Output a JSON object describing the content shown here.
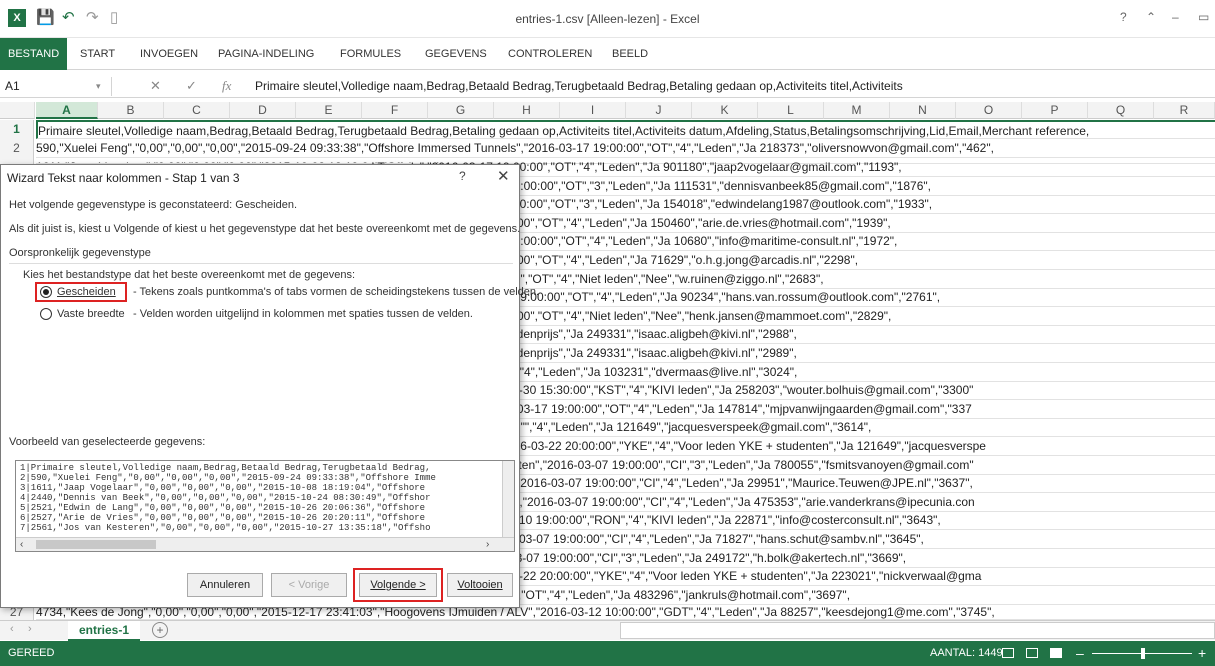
{
  "window": {
    "title": "entries-1.csv  [Alleen-lezen] - Excel",
    "excel_logo": "X",
    "controls": [
      "?",
      "⌃",
      "–",
      "▭"
    ]
  },
  "ribbon": {
    "tabs": [
      "BESTAND",
      "START",
      "INVOEGEN",
      "PAGINA-INDELING",
      "FORMULES",
      "GEGEVENS",
      "CONTROLEREN",
      "BEELD"
    ]
  },
  "formula_bar": {
    "name_box": "A1",
    "fx": "fx",
    "content": "Primaire sleutel,Volledige naam,Bedrag,Betaald Bedrag,Terugbetaald Bedrag,Betaling gedaan op,Activiteits titel,Activiteits"
  },
  "columns": [
    "A",
    "B",
    "C",
    "D",
    "E",
    "F",
    "G",
    "H",
    "I",
    "J",
    "K",
    "L",
    "M",
    "N",
    "O",
    "P",
    "Q",
    "R"
  ],
  "rows": [
    {
      "n": "1",
      "text": "Primaire sleutel,Volledige naam,Bedrag,Betaald Bedrag,Terugbetaald Bedrag,Betaling gedaan op,Activiteits titel,Activiteits datum,Afdeling,Status,Betalingsomschrijving,Lid,Email,Merchant reference,"
    },
    {
      "n": "2",
      "text": "590,\"Xuelei Feng\",\"0,00\",\"0,00\",\"0,00\",\"2015-09-24 09:33:38\",\"Offshore Immersed Tunnels\",\"2016-03-17 19:00:00\",\"OT\",\"4\",\"Leden\",\"Ja 218373\",\"oliversnowvon@gmail.com\",\"462\","
    }
  ],
  "right_rows": [
    "sed Tunnels\",\"2016-03-17 19:00:00\",\"OT\",\"4\",\"Leden\",\"Ja 901180\",\"jaap2vogelaar@gmail.com\",\"1193\",",
    "ersed Tunnels\",\"2016-03-17 19:00:00\",\"OT\",\"3\",\"Leden\",\"Ja 111531\",\"dennisvanbeek85@gmail.com\",\"1876\",",
    "sed Tunnels\",\"2016-03-17 19:00:00\",\"OT\",\"3\",\"Leden\",\"Ja 154018\",\"edwindelang1987@outlook.com\",\"1933\",",
    "d Tunnels\",\"2016-03-17 19:00:00\",\"OT\",\"4\",\"Leden\",\"Ja 150460\",\"arie.de.vries@hotmail.com\",\"1939\",",
    "ersed Tunnels\",\"2016-03-17 19:00:00\",\"OT\",\"4\",\"Leden\",\"Ja 10680\",\"info@maritime-consult.nl\",\"1972\",",
    "d Tunnels\",\"2016-03-17 19:00:00\",\"OT\",\"4\",\"Leden\",\"Ja 71629\",\"o.h.g.jong@arcadis.nl\",\"2298\",",
    "Tunnels\",\"2016-03-17 19:00:00\",\"OT\",\"4\",\"Niet leden\",\"Nee\",\"w.ruinen@ziggo.nl\",\"2683\",",
    "nersed Tunnels\",\"2016-03-17 19:00:00\",\"OT\",\"4\",\"Leden\",\"Ja 90234\",\"hans.van.rossum@outlook.com\",\"2761\",",
    "d Tunnels\",\"2016-03-17 19:00:00\",\"OT\",\"4\",\"Niet leden\",\"Nee\",\"henk.jansen@mammoet.com\",\"2829\",",
    "-03-18 08:00:00\",\"MAI\",\"3\",\"Ledenprijs\",\"Ja 249331\",\"isaac.aligbeh@kivi.nl\",\"2988\",",
    "-03-18 08:00:00\",\"MAI\",\"4\",\"Ledenprijs\",\"Ja 249331\",\"isaac.aligbeh@kivi.nl\",\"2989\",",
    "ions\",\"2016-03-15 19:00:00\",\"\",\"4\",\"Leden\",\"Ja 103231\",\"dvermaas@live.nl\",\"3024\",",
    "et Diederik Samsom\",\"2016-03-30 15:30:00\",\"KST\",\"4\",\"KIVI leden\",\"Ja 258203\",\"wouter.bolhuis@gmail.com\",\"3300\"",
    "ore Immersed Tunnels\",\"2016-03-17 19:00:00\",\"OT\",\"4\",\"Leden\",\"Ja 147814\",\"mjpvanwijngaarden@gmail.com\",\"337",
    "iations\",\"2016-03-15 19:00:00\",\"\",\"4\",\"Leden\",\"Ja 121649\",\"jacquesverspeek@gmail.com\",\"3614\",",
    "unctioneringsgesprekken\",\"2016-03-22 20:00:00\",\"YKE\",\"4\",\"Voor leden YKE + studenten\",\"Ja 121649\",\"jacquesverspe",
    "se resultaatgericht klantbehoeften\",\"2016-03-07 19:00:00\",\"CI\",\"3\",\"Leden\",\"Ja 780055\",\"fsmitsvanoyen@gmail.com\"",
    "sultaatgericht klantbehoeften\",\"2016-03-07 19:00:00\",\"CI\",\"4\",\"Leden\",\"Ja 29951\",\"Maurice.Teuwen@JPE.nl\",\"3637\",",
    "esultaatgericht klantbehoeften\",\"2016-03-07 19:00:00\",\"CI\",\"4\",\"Leden\",\"Ja 475353\",\"arie.vanderkrans@ipecunia.con",
    "Het Empyro Proces\",\"2016-03-10 19:00:00\",\"RON\",\"4\",\"KIVI leden\",\"Ja 22871\",\"info@costerconsult.nl\",\"3643\",",
    "tgericht klantbehoeften\",\"2016-03-07 19:00:00\",\"CI\",\"4\",\"Leden\",\"Ja 71827\",\"hans.schut@sambv.nl\",\"3645\",",
    "ericht klantbehoeften\",\"2016-03-07 19:00:00\",\"CI\",\"3\",\"Leden\",\"Ja 249172\",\"h.bolk@akertech.nl\",\"3669\",",
    "oneringsgesprekken\",\"2016-03-22 20:00:00\",\"YKE\",\"4\",\"Voor leden YKE + studenten\",\"Ja 223021\",\"nickverwaal@gma",
    "unnels\",\"2016-03-17 19:00:00\",\"OT\",\"4\",\"Leden\",\"Ja 483296\",\"jankruls@hotmail.com\",\"3697\","
  ],
  "last_row": {
    "n": "27",
    "text": "4734,\"Kees de Jong\",\"0,00\",\"0,00\",\"0,00\",\"2015-12-17 23:41:03\",\"Hoogovens IJmuiden / ALV\",\"2016-03-12 10:00:00\",\"GDT\",\"4\",\"Leden\",\"Ja 88257\",\"keesdejong1@me.com\",\"3745\","
  },
  "partial_row3": "1611,\"Jaap Vogelaar\",\"0,00\",\"0,00\",\"0,00\",\"2015-10-08 18:19:04\",\"Offshore Immer",
  "dialog": {
    "title": "Wizard Tekst naar kolommen - Stap 1 van 3",
    "help": "?",
    "close": "✕",
    "line1": "Het volgende gegevenstype is geconstateerd: Gescheiden.",
    "line2": "Als dit juist is, kiest u Volgende of kiest u het gegevenstype dat het beste overeenkomt met de gegevens.",
    "group_label": "Oorspronkelijk gegevenstype",
    "choose_label": "Kies het bestandstype dat het beste overeenkomt met de gegevens:",
    "opt1_label": "Gescheiden",
    "opt1_desc": "- Tekens zoals puntkomma's of tabs vormen de scheidingstekens tussen de velden.",
    "opt2_label": "Vaste breedte",
    "opt2_desc": "- Velden worden uitgelijnd in kolommen met spaties tussen de velden.",
    "preview_label": "Voorbeeld van geselecteerde gegevens:",
    "preview_rows": [
      "1|Primaire sleutel,Volledige naam,Bedrag,Betaald Bedrag,Terugbetaald Bedrag,",
      "2|590,\"Xuelei Feng\",\"0,00\",\"0,00\",\"0,00\",\"2015-09-24 09:33:38\",\"Offshore Imme",
      "3|1611,\"Jaap Vogelaar\",\"0,00\",\"0,00\",\"0,00\",\"2015-10-08 18:19:04\",\"Offshore",
      "4|2440,\"Dennis van Beek\",\"0,00\",\"0,00\",\"0,00\",\"2015-10-24 08:30:49\",\"Offshor",
      "5|2521,\"Edwin de Lang\",\"0,00\",\"0,00\",\"0,00\",\"2015-10-26 20:06:36\",\"Offshore",
      "6|2527,\"Arie de Vries\",\"0,00\",\"0,00\",\"0,00\",\"2015-10-26 20:20:11\",\"Offshore",
      "7|2561,\"Jos van Kesteren\",\"0,00\",\"0,00\",\"0,00\",\"2015-10-27 13:35:18\",\"Offsho"
    ],
    "btn_cancel": "Annuleren",
    "btn_prev": "< Vorige",
    "btn_next": "Volgende >",
    "btn_finish": "Voltooien"
  },
  "sheet_tab": "entries-1",
  "status": {
    "left": "GEREED",
    "count": "AANTAL: 1449"
  }
}
